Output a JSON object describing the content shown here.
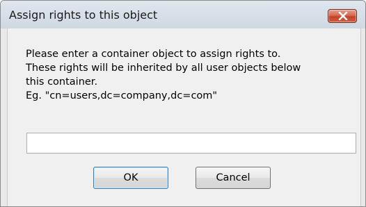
{
  "window": {
    "title": "Assign rights to this object"
  },
  "dialog": {
    "message_lines": [
      "Please enter a container object to assign rights to.",
      "These rights will be inherited by all user objects below",
      "this container.",
      "Eg. \"cn=users,dc=company,dc=com\""
    ],
    "input_value": "",
    "ok_label": "OK",
    "cancel_label": "Cancel"
  },
  "icons": {
    "close": "close-icon"
  },
  "colors": {
    "close_button": "#c9482d",
    "titlebar": "#d6dee7",
    "dialog_background": "#f0f0f0"
  }
}
